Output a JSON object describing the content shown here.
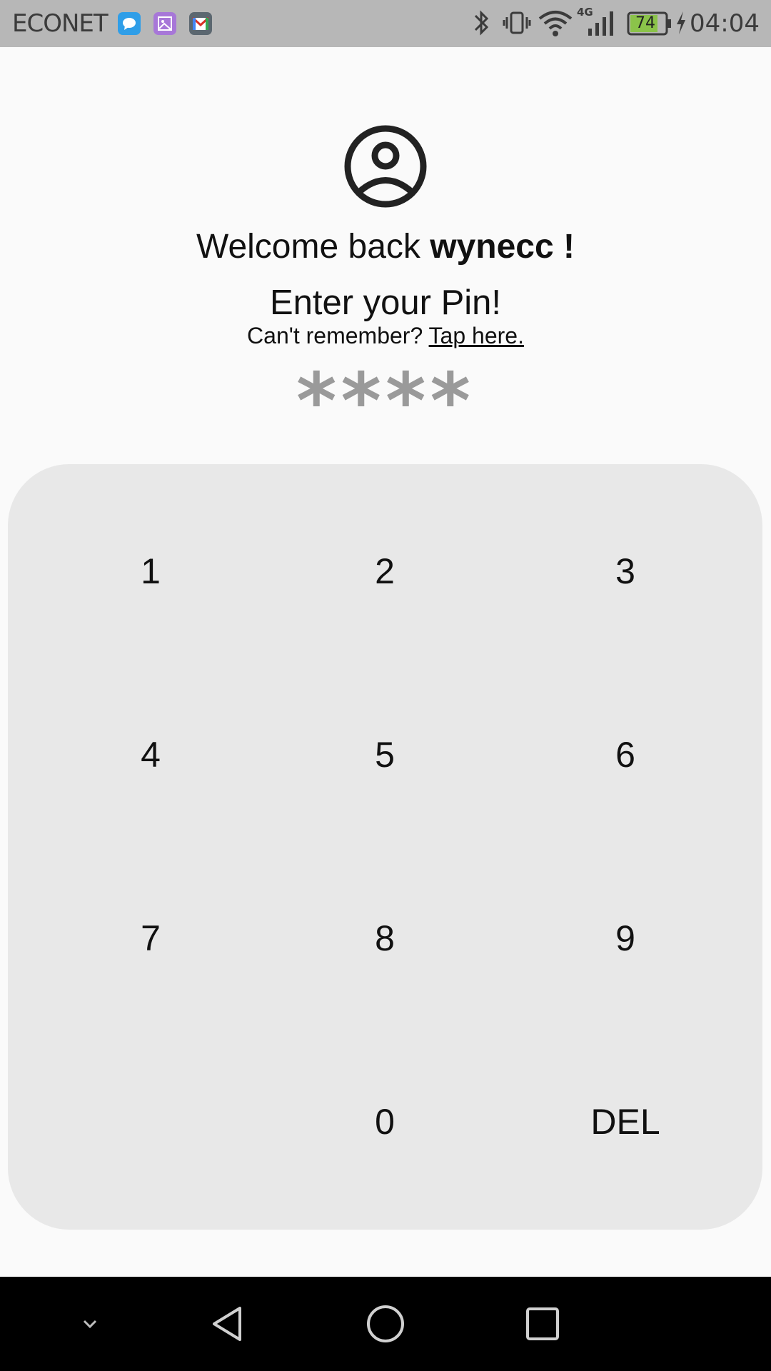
{
  "status_bar": {
    "carrier": "ECONET",
    "network_type": "4G",
    "battery_level": "74",
    "time": "04:04",
    "notification_icons": [
      "messages-icon",
      "gallery-icon",
      "gmail-icon"
    ]
  },
  "login": {
    "welcome_prefix": "Welcome back ",
    "username": "wynecc !",
    "prompt": "Enter your Pin!",
    "forgot_text": "Can't remember? ",
    "forgot_link": "Tap here.",
    "pin_mask": "****"
  },
  "keypad": {
    "keys": [
      "1",
      "2",
      "3",
      "4",
      "5",
      "6",
      "7",
      "8",
      "9",
      "",
      "0",
      "DEL"
    ]
  },
  "colors": {
    "status_bar_bg": "#b7b7b7",
    "page_bg": "#fafafa",
    "keypad_bg": "#e8e8e8",
    "pin_mask": "#9a9a9a",
    "battery_fill": "#8bc34a"
  }
}
